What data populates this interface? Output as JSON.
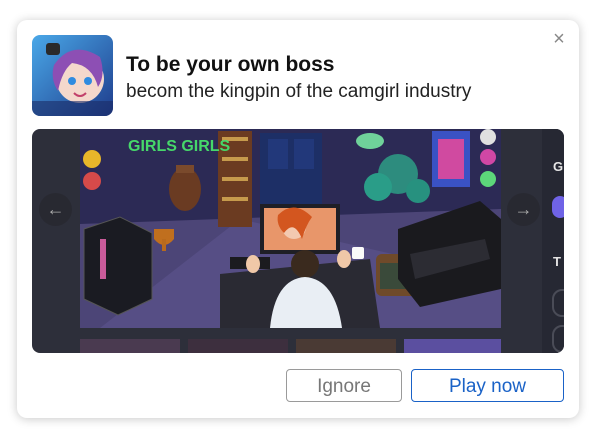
{
  "notification": {
    "title": "To be your own boss",
    "subtitle": "becom the kingpin of the camgirl industry",
    "close_glyph": "×"
  },
  "carousel": {
    "prev_glyph": "←",
    "next_glyph": "→",
    "neon_sign_text": "GIRLS GIRLS",
    "side_heading_1": "G",
    "side_heading_2": "T"
  },
  "actions": {
    "ignore_label": "Ignore",
    "play_label": "Play now"
  },
  "icons": {
    "close": "close-icon",
    "prev": "arrow-left-icon",
    "next": "arrow-right-icon"
  },
  "colors": {
    "accent": "#1a62c7",
    "panel": "#2d2f3a",
    "side_dot": "#6f63e6",
    "neon": "#46d86a"
  }
}
